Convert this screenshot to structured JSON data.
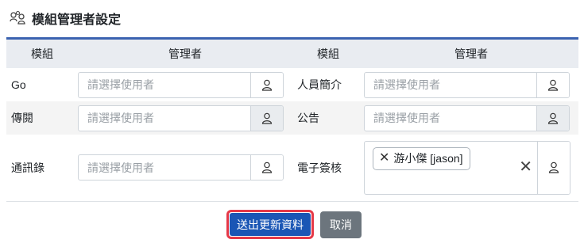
{
  "page": {
    "title": "模組管理者設定",
    "title_icon": "users-icon"
  },
  "table": {
    "headers": [
      "模組",
      "管理者",
      "模組",
      "管理者"
    ],
    "rows": [
      {
        "left_module": "Go",
        "left_placeholder": "請選擇使用者",
        "right_module": "人員簡介",
        "right_placeholder": "請選擇使用者"
      },
      {
        "left_module": "傳閱",
        "left_placeholder": "請選擇使用者",
        "right_module": "公告",
        "right_placeholder": "請選擇使用者"
      },
      {
        "left_module": "通訊錄",
        "left_placeholder": "請選擇使用者",
        "right_module": "電子簽核",
        "right_selected": [
          "游小傑 [jason]"
        ]
      }
    ]
  },
  "actions": {
    "submit_label": "送出更新資料",
    "cancel_label": "取消"
  },
  "colors": {
    "header_rule": "#3a62b0",
    "header_bg": "#e9ecf1",
    "submit_bg": "#1a56b5",
    "submit_highlight": "#e53948",
    "cancel_bg": "#6c757d"
  }
}
